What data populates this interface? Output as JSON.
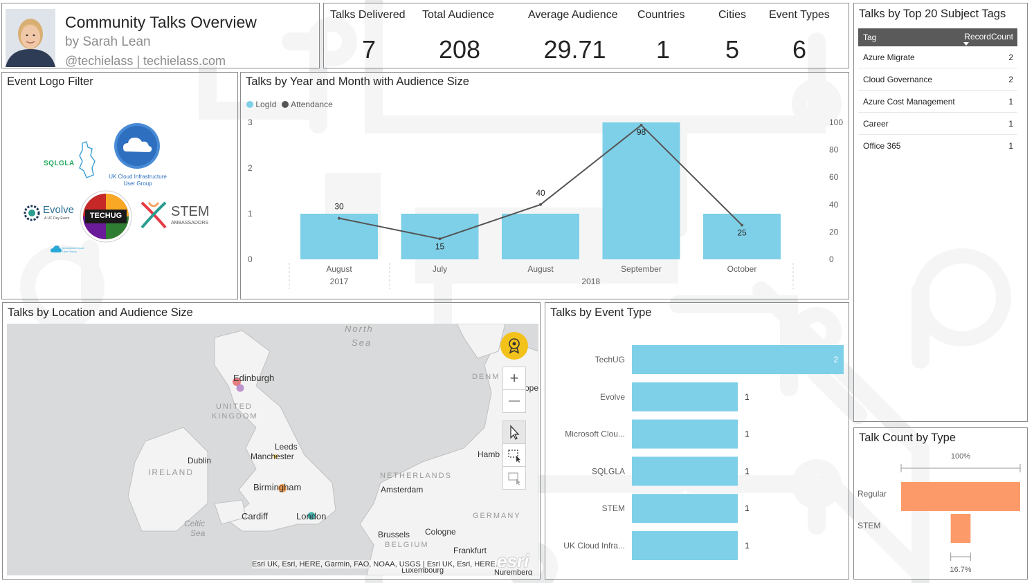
{
  "header": {
    "title": "Community Talks Overview",
    "byline": "by Sarah Lean",
    "handle": "@techielass | techielass.com"
  },
  "kpis": [
    {
      "label": "Talks Delivered",
      "value": "7"
    },
    {
      "label": "Total Audience",
      "value": "208"
    },
    {
      "label": "Average Audience",
      "value": "29.71"
    },
    {
      "label": "Countries",
      "value": "1"
    },
    {
      "label": "Cities",
      "value": "5"
    },
    {
      "label": "Event Types",
      "value": "6"
    }
  ],
  "logo_filter": {
    "title": "Event Logo Filter",
    "logos": {
      "sqlgla": "SQLGLA",
      "ukcloud_line1": "UK Cloud Infrastructure",
      "ukcloud_line2": "User Group",
      "evolve": "Evolve",
      "evolve_sub": "A UC Day Event",
      "techug": "TECHUG",
      "stem": "STEM",
      "stem_sub": "AMBASSADORS",
      "mcug": "ManchesterCloud User Group"
    }
  },
  "tags": {
    "title": "Talks by Top 20 Subject Tags",
    "col_tag": "Tag",
    "col_count": "RecordCount",
    "rows": [
      {
        "tag": "Azure Migrate",
        "count": "2"
      },
      {
        "tag": "Cloud Governance",
        "count": "2"
      },
      {
        "tag": "Azure Cost Management",
        "count": "1"
      },
      {
        "tag": "Career",
        "count": "1"
      },
      {
        "tag": "Office 365",
        "count": "1"
      }
    ]
  },
  "map": {
    "title": "Talks by Location and Audience Size",
    "labels": {
      "north_sea_1": "North",
      "north_sea_2": "Sea",
      "edinburgh": "Edinburgh",
      "uk_1": "UNITED",
      "uk_2": "KINGDOM",
      "leeds": "Leeds",
      "manchester": "Manchester",
      "dublin": "Dublin",
      "ireland": "IRELAND",
      "birmingham": "Birmingham",
      "cardiff": "Cardiff",
      "london": "London",
      "celtic_1": "Celtic",
      "celtic_2": "Sea",
      "netherlands": "NETHERLANDS",
      "amsterdam": "Amsterdam",
      "germany": "GERMANY",
      "hamburg": "Hamb",
      "denmark": "DENM",
      "copenhagen": "ope",
      "brussels": "Brussels",
      "belgium": "BELGIUM",
      "cologne": "Cologne",
      "frankfurt": "Frankfurt",
      "luxembourg": "Luxembourg",
      "nuremberg": "Nuremberg"
    },
    "attribution": "Esri UK, Esri, HERE, Garmin, FAO, NOAA, USGS | Esri UK, Esri, HERE...",
    "esri": "esri",
    "zoom_in": "+",
    "zoom_out": "—"
  },
  "event_types": {
    "title": "Talks by Event Type",
    "chart_data": {
      "type": "bar",
      "orientation": "horizontal",
      "categories": [
        "TechUG",
        "Evolve",
        "Microsoft Clou...",
        "SQLGLA",
        "STEM",
        "UK Cloud Infra..."
      ],
      "values": [
        2,
        1,
        1,
        1,
        1,
        1
      ],
      "color": "#7ed0e8"
    }
  },
  "talk_type": {
    "title": "Talk Count by Type",
    "chart_data": {
      "type": "bar",
      "orientation": "funnel",
      "categories": [
        "Regular",
        "STEM"
      ],
      "values": [
        6,
        1
      ],
      "top_label": "100%",
      "bottom_label": "16.7%",
      "color": "#fd9a6a"
    }
  },
  "combo": {
    "title": "Talks by Year and Month with Audience Size",
    "legend": [
      {
        "name": "LogId",
        "color": "#7ed0e8"
      },
      {
        "name": "Attendance",
        "color": "#555555"
      }
    ],
    "chart_data": {
      "type": "bar",
      "categories": [
        "August",
        "July",
        "August",
        "September",
        "October"
      ],
      "year_groups": [
        {
          "label": "2017",
          "span": [
            0,
            0
          ]
        },
        {
          "label": "2018",
          "span": [
            1,
            4
          ]
        }
      ],
      "series": [
        {
          "name": "LogId",
          "type": "bar",
          "axis": "left",
          "values": [
            1,
            1,
            1,
            3,
            1
          ]
        },
        {
          "name": "Attendance",
          "type": "line",
          "axis": "right",
          "values": [
            30,
            15,
            40,
            98,
            25
          ]
        }
      ],
      "y_left": {
        "range": [
          0,
          3
        ],
        "ticks": [
          "0",
          "1",
          "2",
          "3"
        ]
      },
      "y_right": {
        "range": [
          0,
          100
        ],
        "ticks": [
          "0",
          "20",
          "40",
          "60",
          "80",
          "100"
        ]
      },
      "data_labels": [
        "30",
        "15",
        "40",
        "98",
        "25"
      ]
    }
  }
}
